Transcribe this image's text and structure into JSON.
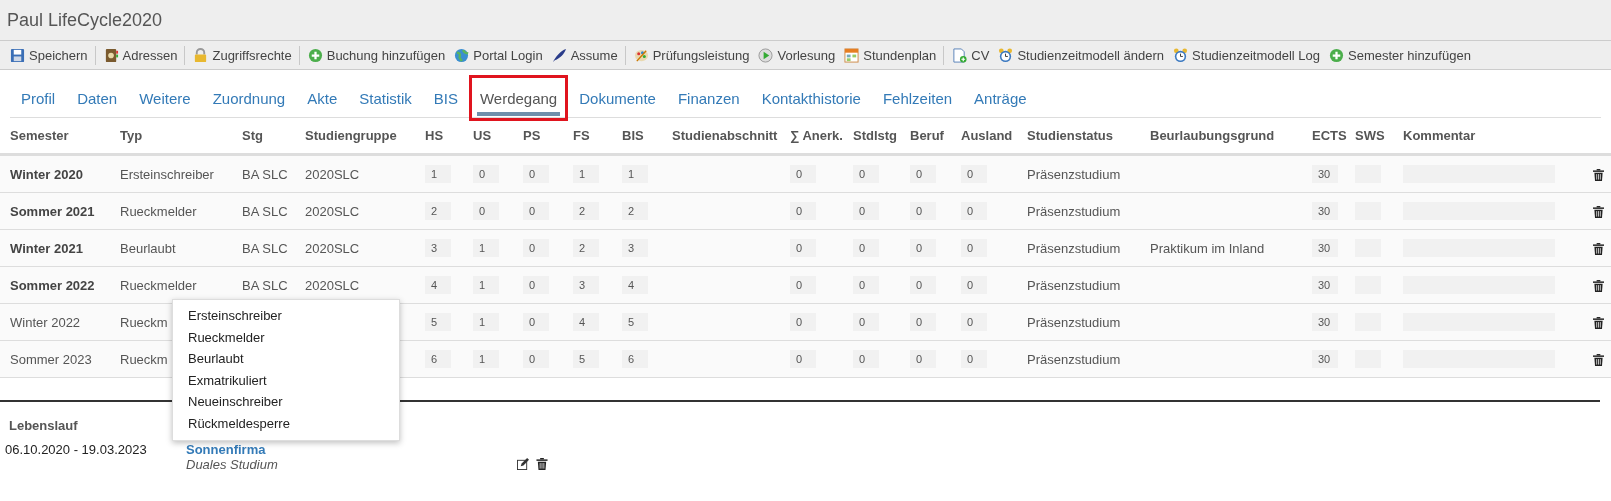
{
  "window": {
    "title": "Paul LifeCycle2020"
  },
  "toolbar": [
    {
      "kind": "save",
      "label": "Speichern",
      "separator": true
    },
    {
      "kind": "addressbook",
      "label": "Adressen",
      "separator": true
    },
    {
      "kind": "lock",
      "label": "Zugriffsrechte",
      "separator": true
    },
    {
      "kind": "plus",
      "label": "Buchung hinzufügen",
      "separator": false
    },
    {
      "kind": "globe",
      "label": "Portal Login",
      "separator": false
    },
    {
      "kind": "quill",
      "label": "Assume",
      "separator": true
    },
    {
      "kind": "palette",
      "label": "Prüfungsleistung",
      "separator": false
    },
    {
      "kind": "presentation",
      "label": "Vorlesung",
      "separator": false
    },
    {
      "kind": "calendar",
      "label": "Stundenplan",
      "separator": true
    },
    {
      "kind": "document",
      "label": "CV",
      "separator": false
    },
    {
      "kind": "clock",
      "label": "Studienzeitmodell ändern",
      "separator": false
    },
    {
      "kind": "clock",
      "label": "Studienzeitmodell Log",
      "separator": false
    },
    {
      "kind": "plus",
      "label": "Semester hinzufügen",
      "separator": false
    }
  ],
  "tabs": [
    {
      "label": "Profil",
      "selected": false,
      "highlighted": false
    },
    {
      "label": "Daten",
      "selected": false,
      "highlighted": false
    },
    {
      "label": "Weitere",
      "selected": false,
      "highlighted": false
    },
    {
      "label": "Zuordnung",
      "selected": false,
      "highlighted": false
    },
    {
      "label": "Akte",
      "selected": false,
      "highlighted": false
    },
    {
      "label": "Statistik",
      "selected": false,
      "highlighted": false
    },
    {
      "label": "BIS",
      "selected": false,
      "highlighted": false
    },
    {
      "label": "Werdegang",
      "selected": true,
      "highlighted": true
    },
    {
      "label": "Dokumente",
      "selected": false,
      "highlighted": false
    },
    {
      "label": "Finanzen",
      "selected": false,
      "highlighted": false
    },
    {
      "label": "Kontakthistorie",
      "selected": false,
      "highlighted": false
    },
    {
      "label": "Fehlzeiten",
      "selected": false,
      "highlighted": false
    },
    {
      "label": "Anträge",
      "selected": false,
      "highlighted": false
    }
  ],
  "table": {
    "columns": [
      "Semester",
      "Typ",
      "Stg",
      "Studiengruppe",
      "HS",
      "US",
      "PS",
      "FS",
      "BIS",
      "Studienabschnitt",
      "∑ Anerk.",
      "Stdlstg",
      "Beruf",
      "Ausland",
      "Studienstatus",
      "Beurlaubungsgrund",
      "ECTS",
      "SWS",
      "Kommentar"
    ],
    "rows": [
      {
        "semester": "Winter 2020",
        "emphasized": true,
        "typ": "Ersteinschreiber",
        "stg": "BA SLC",
        "studiengruppe": "2020SLC",
        "hs": "1",
        "us": "0",
        "ps": "0",
        "fs": "1",
        "bis": "1",
        "anerk": "0",
        "stdlstg": "0",
        "beruf": "0",
        "ausland": "0",
        "studienstatus": "Präsenzstudium",
        "ects": "30"
      },
      {
        "semester": "Sommer 2021",
        "emphasized": true,
        "typ": "Rueckmelder",
        "stg": "BA SLC",
        "studiengruppe": "2020SLC",
        "hs": "2",
        "us": "0",
        "ps": "0",
        "fs": "2",
        "bis": "2",
        "anerk": "0",
        "stdlstg": "0",
        "beruf": "0",
        "ausland": "0",
        "studienstatus": "Präsenzstudium",
        "ects": "30"
      },
      {
        "semester": "Winter 2021",
        "emphasized": true,
        "typ": "Beurlaubt",
        "stg": "BA SLC",
        "studiengruppe": "2020SLC",
        "hs": "3",
        "us": "1",
        "ps": "0",
        "fs": "2",
        "bis": "3",
        "anerk": "0",
        "stdlstg": "0",
        "beruf": "0",
        "ausland": "0",
        "studienstatus": "Präsenzstudium",
        "beurlaubungsgrund": "Praktikum im Inland",
        "ects": "30"
      },
      {
        "semester": "Sommer 2022",
        "emphasized": true,
        "typ": "Rueckmelder",
        "stg": "BA SLC",
        "studiengruppe": "2020SLC",
        "hs": "4",
        "us": "1",
        "ps": "0",
        "fs": "3",
        "bis": "4",
        "anerk": "0",
        "stdlstg": "0",
        "beruf": "0",
        "ausland": "0",
        "studienstatus": "Präsenzstudium",
        "ects": "30"
      },
      {
        "semester": "Winter 2022",
        "emphasized": false,
        "typ": "Rueckm",
        "hs": "5",
        "us": "1",
        "ps": "0",
        "fs": "4",
        "bis": "5",
        "anerk": "0",
        "stdlstg": "0",
        "beruf": "0",
        "ausland": "0",
        "studienstatus": "Präsenzstudium",
        "ects": "30"
      },
      {
        "semester": "Sommer 2023",
        "emphasized": false,
        "typ": "Rueckm",
        "hs": "6",
        "us": "1",
        "ps": "0",
        "fs": "5",
        "bis": "6",
        "anerk": "0",
        "stdlstg": "0",
        "beruf": "0",
        "ausland": "0",
        "studienstatus": "Präsenzstudium",
        "ects": "30"
      }
    ]
  },
  "type_menu": [
    {
      "label": "Ersteinschreiber",
      "selected": false
    },
    {
      "label": "Rueckmelder",
      "selected": false
    },
    {
      "label": "Beurlaubt",
      "selected": false
    },
    {
      "label": "Exmatrikuliert",
      "selected": false
    },
    {
      "label": "Neueinschreiber",
      "selected": false
    },
    {
      "label": "Rückmeldesperre",
      "selected": false
    }
  ],
  "lebenslauf": {
    "heading": "Lebenslauf",
    "entries": [
      {
        "period": "06.10.2020 - 19.03.2023",
        "title": "Sonnenfirma",
        "subtitle": "Duales Studium"
      }
    ]
  }
}
